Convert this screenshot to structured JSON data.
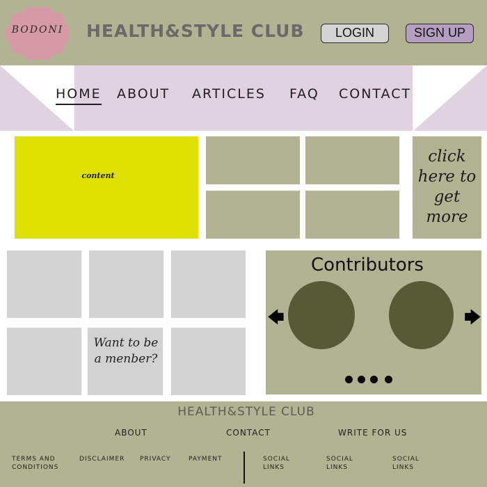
{
  "header": {
    "logo_text": "BODONI",
    "site_title": "HEALTH&STYLE CLUB",
    "login_label": "LOGIN",
    "signup_label": "SIGN UP"
  },
  "nav": {
    "items": [
      {
        "label": "HOME",
        "active": true
      },
      {
        "label": "ABOUT"
      },
      {
        "label": "ARTICLES"
      },
      {
        "label": "FAQ"
      },
      {
        "label": "CONTACT"
      }
    ]
  },
  "featured": {
    "label": "content"
  },
  "promo": {
    "click_more": "click\nhere to\nget\nmore"
  },
  "membership": {
    "label": "Want to be\na menber?"
  },
  "contributors": {
    "title": "Contributors",
    "prev_icon": "arrow-left-icon",
    "next_icon": "arrow-right-icon",
    "page_dots": 4
  },
  "footer": {
    "title": "HEALTH&STYLE CLUB",
    "links": [
      "ABOUT",
      "CONTACT",
      "WRITE FOR US"
    ],
    "small_links": [
      "TERMS AND\nCONDITIONS",
      "DISCLAIMER",
      "PRIVACY",
      "PAYMENT"
    ],
    "social_links": [
      "SOCIAL\nLINKS",
      "SOCIAL\nLINKS",
      "SOCIAL\nLINKS"
    ]
  },
  "colors": {
    "header_bg": "#b1b393",
    "nav_bg": "#e0d3df",
    "featured_bg": "#dde000",
    "grey_tile": "#d2d2d2",
    "avatar": "#575a34",
    "logo": "#d69aa6",
    "signup_bg": "#b49fc3"
  }
}
